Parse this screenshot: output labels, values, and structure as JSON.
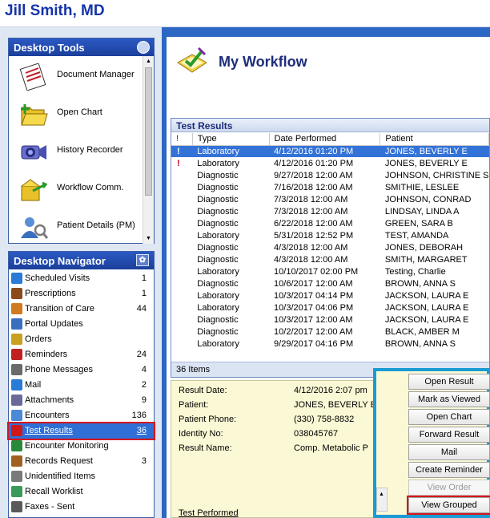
{
  "header": {
    "user_name": "Jill Smith, MD"
  },
  "desktop_tools": {
    "title": "Desktop Tools",
    "items": [
      {
        "label": "Document Manager",
        "icon": "document-manager-icon"
      },
      {
        "label": "Open Chart",
        "icon": "open-chart-icon"
      },
      {
        "label": "History Recorder",
        "icon": "history-recorder-icon"
      },
      {
        "label": "Workflow Comm.",
        "icon": "workflow-comm-icon"
      },
      {
        "label": "Patient Details (PM)",
        "icon": "patient-details-icon"
      }
    ]
  },
  "desktop_navigator": {
    "title": "Desktop Navigator",
    "items": [
      {
        "label": "Scheduled Visits",
        "count": "1"
      },
      {
        "label": "Prescriptions",
        "count": "1"
      },
      {
        "label": "Transition of Care",
        "count": "44"
      },
      {
        "label": "Portal Updates",
        "count": ""
      },
      {
        "label": "Orders",
        "count": ""
      },
      {
        "label": "Reminders",
        "count": "24"
      },
      {
        "label": "Phone Messages",
        "count": "4"
      },
      {
        "label": "Mail",
        "count": "2"
      },
      {
        "label": "Attachments",
        "count": "9"
      },
      {
        "label": "Encounters",
        "count": "136"
      },
      {
        "label": "Test Results",
        "count": "36"
      },
      {
        "label": "Encounter Monitoring",
        "count": ""
      },
      {
        "label": "Records Request",
        "count": "3"
      },
      {
        "label": "Unidentified Items",
        "count": ""
      },
      {
        "label": "Recall Worklist",
        "count": ""
      },
      {
        "label": "Faxes - Sent",
        "count": ""
      }
    ],
    "selected": "Test Results"
  },
  "workflow": {
    "title": "My Workflow"
  },
  "test_results": {
    "title": "Test Results",
    "columns": [
      "!",
      "Type",
      "Date Performed",
      "Patient"
    ],
    "rows": [
      {
        "flag": "!",
        "type": "Laboratory",
        "date": "4/12/2016 01:20 PM",
        "patient": "JONES, BEVERLY E"
      },
      {
        "flag": "!",
        "type": "Laboratory",
        "date": "4/12/2016 01:20 PM",
        "patient": "JONES, BEVERLY E"
      },
      {
        "flag": "",
        "type": "Diagnostic",
        "date": "9/27/2018 12:00 AM",
        "patient": "JOHNSON, CHRISTINE S"
      },
      {
        "flag": "",
        "type": "Diagnostic",
        "date": "7/16/2018 12:00 AM",
        "patient": "SMITHIE, LESLEE"
      },
      {
        "flag": "",
        "type": "Diagnostic",
        "date": "7/3/2018 12:00 AM",
        "patient": "JOHNSON, CONRAD"
      },
      {
        "flag": "",
        "type": "Diagnostic",
        "date": "7/3/2018 12:00 AM",
        "patient": "LINDSAY, LINDA A"
      },
      {
        "flag": "",
        "type": "Diagnostic",
        "date": "6/22/2018 12:00 AM",
        "patient": "GREEN, SARA B"
      },
      {
        "flag": "",
        "type": "Laboratory",
        "date": "5/31/2018 12:52 PM",
        "patient": "TEST, AMANDA"
      },
      {
        "flag": "",
        "type": "Diagnostic",
        "date": "4/3/2018 12:00 AM",
        "patient": "JONES, DEBORAH"
      },
      {
        "flag": "",
        "type": "Diagnostic",
        "date": "4/3/2018 12:00 AM",
        "patient": "SMITH, MARGARET"
      },
      {
        "flag": "",
        "type": "Laboratory",
        "date": "10/10/2017 02:00 PM",
        "patient": "Testing, Charlie"
      },
      {
        "flag": "",
        "type": "Diagnostic",
        "date": "10/6/2017 12:00 AM",
        "patient": "BROWN, ANNA S"
      },
      {
        "flag": "",
        "type": "Laboratory",
        "date": "10/3/2017 04:14 PM",
        "patient": "JACKSON, LAURA E"
      },
      {
        "flag": "",
        "type": "Laboratory",
        "date": "10/3/2017 04:06 PM",
        "patient": "JACKSON, LAURA E"
      },
      {
        "flag": "",
        "type": "Diagnostic",
        "date": "10/3/2017 12:00 AM",
        "patient": "JACKSON, LAURA E"
      },
      {
        "flag": "",
        "type": "Diagnostic",
        "date": "10/2/2017 12:00 AM",
        "patient": "BLACK, AMBER M"
      },
      {
        "flag": "",
        "type": "Laboratory",
        "date": "9/29/2017 04:16 PM",
        "patient": "BROWN, ANNA S"
      }
    ],
    "selected_row": 0,
    "footer": "36 Items"
  },
  "detail": {
    "fields": [
      {
        "label": "Result Date:",
        "value": "4/12/2016 2:07 pm"
      },
      {
        "label": "Patient:",
        "value": "JONES, BEVERLY E"
      },
      {
        "label": "Patient Phone:",
        "value": "(330) 758-8832"
      },
      {
        "label": "Identity No:",
        "value": "038045767"
      },
      {
        "label": "Result Name:",
        "value": "Comp. Metabolic P"
      }
    ],
    "section_label": "Test Performed"
  },
  "actions": {
    "buttons": [
      {
        "label": "Open Result",
        "enabled": true
      },
      {
        "label": "Mark as Viewed",
        "enabled": true
      },
      {
        "label": "Open Chart",
        "enabled": true
      },
      {
        "label": "Forward Result",
        "enabled": true
      },
      {
        "label": "Mail",
        "enabled": true
      },
      {
        "label": "Create Reminder",
        "enabled": true
      },
      {
        "label": "View Order",
        "enabled": false
      },
      {
        "label": "View Grouped",
        "enabled": true
      }
    ]
  },
  "colors": {
    "title_blue": "#1634a8",
    "panel_header": "#2b59c3",
    "selection": "#3373d8",
    "highlight_red": "#d8151b",
    "action_frame": "#1a9bd3",
    "detail_bg": "#fbf8d5"
  }
}
